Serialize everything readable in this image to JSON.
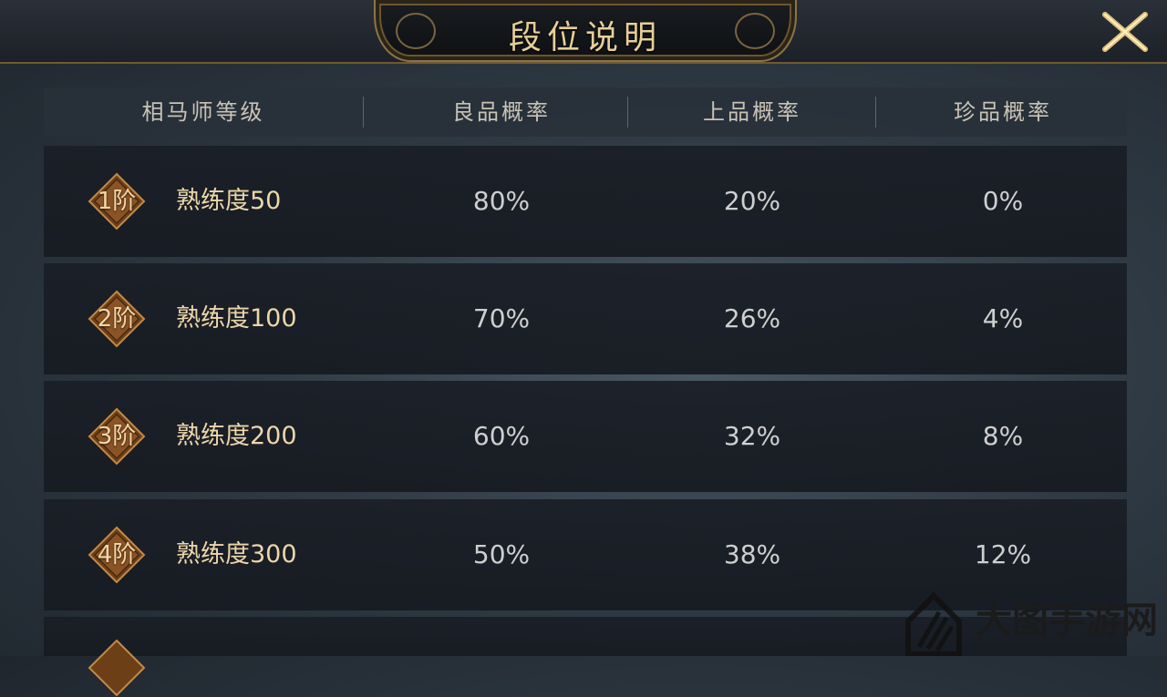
{
  "page": {
    "title": "段位说明"
  },
  "table": {
    "headers": [
      "相马师等级",
      "良品概率",
      "上品概率",
      "珍品概率"
    ],
    "rows": [
      {
        "badge": "1阶",
        "level": "熟练度50",
        "good": "80%",
        "fine": "20%",
        "rare": "0%"
      },
      {
        "badge": "2阶",
        "level": "熟练度100",
        "good": "70%",
        "fine": "26%",
        "rare": "4%"
      },
      {
        "badge": "3阶",
        "level": "熟练度200",
        "good": "60%",
        "fine": "32%",
        "rare": "8%"
      },
      {
        "badge": "4阶",
        "level": "熟练度300",
        "good": "50%",
        "fine": "38%",
        "rare": "12%"
      }
    ]
  },
  "watermark": {
    "text": "大图手游网"
  },
  "colors": {
    "gold": "#e7cf98",
    "badge": "#7a4a1e",
    "rowBg": "#1b2029"
  },
  "icons": {
    "close": "close-x-icon",
    "badge": "diamond-badge-icon",
    "watermark": "house-logo-icon"
  }
}
